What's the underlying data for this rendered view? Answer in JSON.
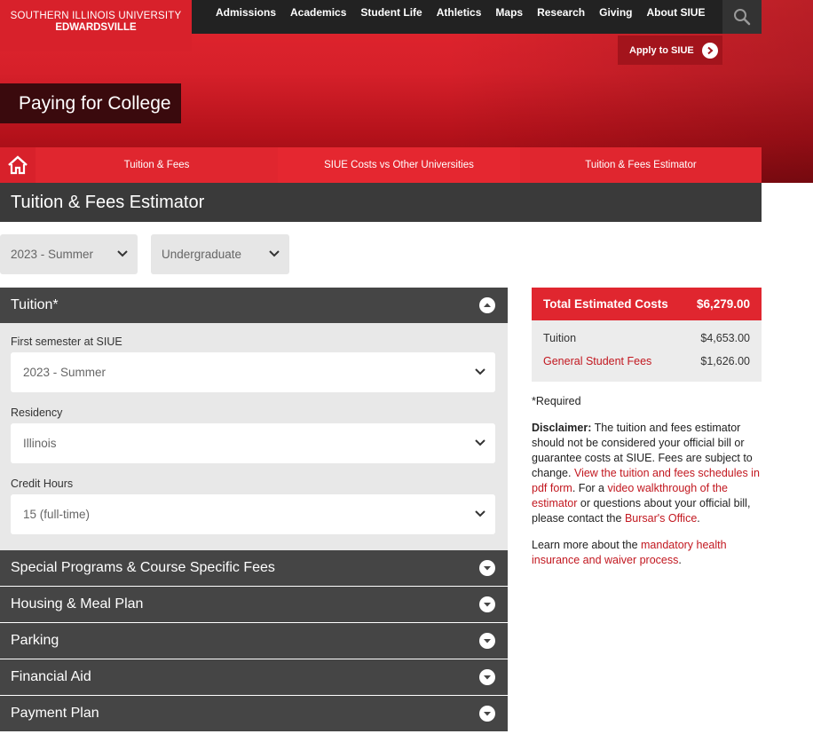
{
  "logo": {
    "line1": "SOUTHERN ILLINOIS UNIVERSITY",
    "line2": "EDWARDSVILLE"
  },
  "topnav": [
    "Admissions",
    "Academics",
    "Student Life",
    "Athletics",
    "Maps",
    "Research",
    "Giving",
    "About SIUE"
  ],
  "apply": {
    "label": "Apply to SIUE"
  },
  "page_title": "Paying for College",
  "subnav": {
    "tab1": "Tuition & Fees",
    "tab2": "SIUE Costs vs Other Universities",
    "tab3": "Tuition & Fees Estimator"
  },
  "section_title": "Tuition & Fees Estimator",
  "filters": {
    "term": "2023 - Summer",
    "level": "Undergraduate"
  },
  "tuition": {
    "title": "Tuition*",
    "first_semester_label": "First semester at SIUE",
    "first_semester_value": "2023 - Summer",
    "residency_label": "Residency",
    "residency_value": "Illinois",
    "credit_hours_label": "Credit Hours",
    "credit_hours_value": "15 (full-time)"
  },
  "accordions": [
    "Special Programs & Course Specific Fees",
    "Housing & Meal Plan",
    "Parking",
    "Financial Aid",
    "Payment Plan"
  ],
  "summary": {
    "title": "Total Estimated Costs",
    "total": "$6,279.00",
    "rows": [
      {
        "label": "Tuition",
        "value": "$4,653.00"
      },
      {
        "label": "General Student Fees",
        "value": "$1,626.00"
      }
    ]
  },
  "side": {
    "required": "*Required",
    "disclaimer_label": "Disclaimer:",
    "disclaimer_text1": " The tuition and fees estimator should not be considered your official bill or guarantee costs at SIUE. Fees are subject to change. ",
    "link_schedules": "View the tuition and fees schedules in pdf form",
    "text2": ". For a ",
    "link_video": "video walkthrough of the estimator",
    "text3": " or questions about your official bill, please contact the ",
    "link_bursar": "Bursar's Office",
    "text4": ".",
    "learn_text": "Learn more about the ",
    "link_insurance": "mandatory health insurance and waiver process",
    "learn_end": "."
  },
  "colors": {
    "brand_red": "#e0262f",
    "dark_bar": "#454545",
    "link_red": "#c2171f"
  },
  "icons": {
    "search": "search-icon",
    "home": "home-icon",
    "chevron": "chevron-down-icon",
    "arrow": "arrow-right-circle-icon"
  }
}
